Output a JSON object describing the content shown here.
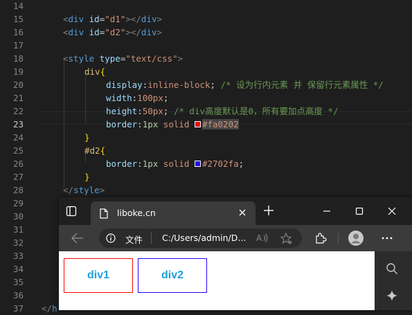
{
  "editor": {
    "lines": [
      {
        "n": "14"
      },
      {
        "n": "15"
      },
      {
        "n": "16"
      },
      {
        "n": "17"
      },
      {
        "n": "18"
      },
      {
        "n": "19"
      },
      {
        "n": "20"
      },
      {
        "n": "21"
      },
      {
        "n": "22"
      },
      {
        "n": "23"
      },
      {
        "n": "24"
      },
      {
        "n": "25"
      },
      {
        "n": "26"
      },
      {
        "n": "27"
      },
      {
        "n": "28"
      },
      {
        "n": "29"
      },
      {
        "n": "30"
      },
      {
        "n": "31"
      },
      {
        "n": "32"
      },
      {
        "n": "33"
      },
      {
        "n": "34"
      },
      {
        "n": "35"
      },
      {
        "n": "36"
      },
      {
        "n": "37"
      }
    ],
    "active_line": "23",
    "code": {
      "l15": {
        "open": "<",
        "tag": "div",
        "attr": "id",
        "eq": "=",
        "val": "\"d1\"",
        "close": "></",
        "tag2": "div",
        "end": ">"
      },
      "l16": {
        "open": "<",
        "tag": "div",
        "attr": "id",
        "eq": "=",
        "val": "\"d2\"",
        "close": "></",
        "tag2": "div",
        "end": ">"
      },
      "l18": {
        "open": "<",
        "tag": "style",
        "attr": "type",
        "eq": "=",
        "val": "\"text/css\"",
        "end": ">"
      },
      "l19": {
        "sel": "div",
        "brace": "{"
      },
      "l20": {
        "prop": "display",
        "colon": ":",
        "val": "inline-block",
        "semi": ";",
        "comment": " /* 设为行内元素 并 保留行元素属性 */"
      },
      "l21": {
        "prop": "width",
        "colon": ":",
        "val": "100px",
        "semi": ";"
      },
      "l22": {
        "prop": "height",
        "colon": ":",
        "val": "50px",
        "semi": ";",
        "comment": " /* div高度默认是0，所有要加点高度 */"
      },
      "l23": {
        "prop": "border",
        "colon": ":",
        "num": "1px",
        "kw": " solid ",
        "color": "#fa0202"
      },
      "l24": {
        "brace": "}"
      },
      "l25": {
        "sel": "#d2",
        "brace": "{"
      },
      "l26": {
        "prop": "border",
        "colon": ":",
        "num": "1px",
        "kw": " solid ",
        "color": "#2702fa",
        "semi": ";"
      },
      "l27": {
        "brace": "}"
      },
      "l28": {
        "open": "</",
        "tag": "style",
        "end": ">"
      },
      "l37": {
        "open": "</",
        "tag": "h"
      }
    },
    "swatch_colors": {
      "red": "#fa0202",
      "blue": "#2702fa"
    }
  },
  "browser": {
    "tab": {
      "title": "liboke.cn",
      "favicon": "page-icon"
    },
    "address": {
      "site_label": "文件",
      "url": "C:/Users/admin/D..."
    },
    "icons": [
      "tab-actions-icon",
      "close-tab-icon",
      "new-tab-icon",
      "minimize-icon",
      "maximize-icon",
      "close-window-icon",
      "back-icon",
      "info-icon",
      "read-aloud-icon",
      "add-favorite-icon",
      "extensions-icon",
      "profile-icon",
      "more-icon",
      "search-icon",
      "copilot-icon"
    ],
    "page": {
      "boxes": [
        {
          "label": "div1",
          "border": "#fa0202"
        },
        {
          "label": "div2",
          "border": "#2702fa"
        }
      ],
      "text_color": "#1ea0e0"
    }
  }
}
